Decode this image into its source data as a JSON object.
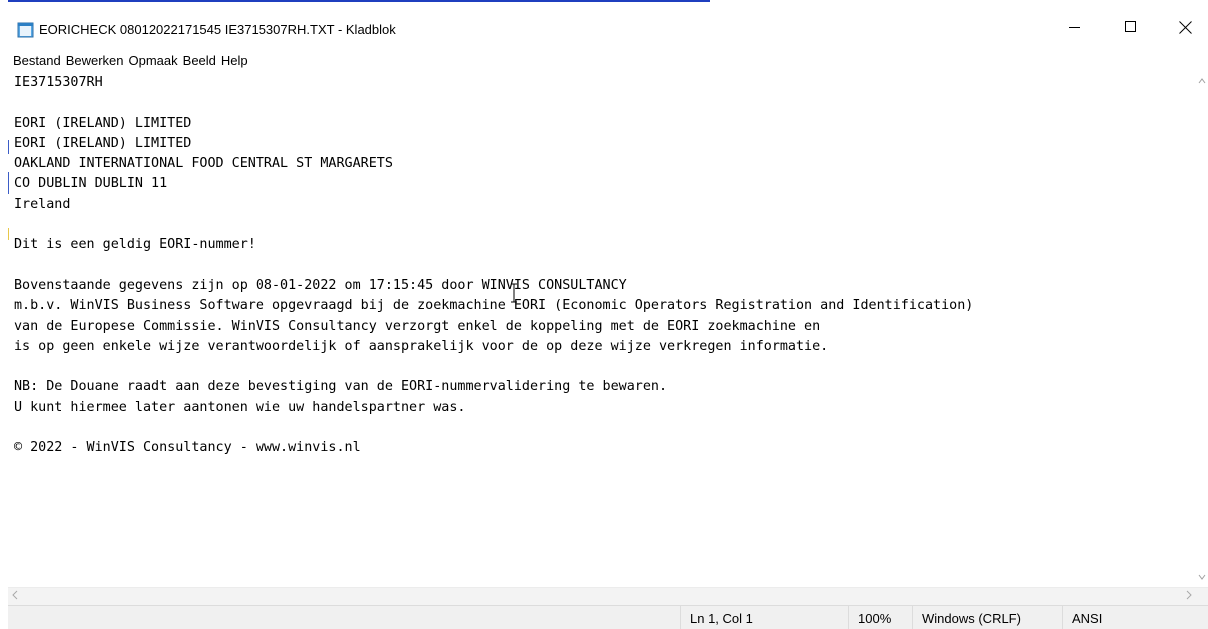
{
  "window": {
    "title": "EORICHECK 08012022171545 IE3715307RH.TXT - Kladblok",
    "app_icon": "notepad-icon",
    "controls": {
      "minimize_icon": "minimize-icon",
      "maximize_icon": "maximize-icon",
      "close_icon": "close-icon"
    }
  },
  "menu": {
    "items": [
      "Bestand",
      "Bewerken",
      "Opmaak",
      "Beeld",
      "Help"
    ]
  },
  "document": {
    "lines": [
      "IE3715307RH",
      "",
      "EORI (IRELAND) LIMITED",
      "EORI (IRELAND) LIMITED",
      "OAKLAND INTERNATIONAL FOOD CENTRAL ST MARGARETS",
      "CO DUBLIN DUBLIN 11",
      "Ireland",
      "",
      "Dit is een geldig EORI-nummer!",
      "",
      "Bovenstaande gegevens zijn op 08-01-2022 om 17:15:45 door WINVIS CONSULTANCY",
      "m.b.v. WinVIS Business Software opgevraagd bij de zoekmachine EORI (Economic Operators Registration and Identification)",
      "van de Europese Commissie. WinVIS Consultancy verzorgt enkel de koppeling met de EORI zoekmachine en",
      "is op geen enkele wijze verantwoordelijk of aansprakelijk voor de op deze wijze verkregen informatie.",
      "",
      "NB: De Douane raadt aan deze bevestiging van de EORI-nummervalidering te bewaren.",
      "U kunt hiermee later aantonen wie uw handelspartner was.",
      "",
      "© 2022 - WinVIS Consultancy - www.winvis.nl"
    ]
  },
  "statusbar": {
    "position": "Ln 1, Col 1",
    "zoom": "100%",
    "line_ending": "Windows (CRLF)",
    "encoding": "ANSI"
  },
  "colors": {
    "accent": "#1f3fbf",
    "statusbar_bg": "#f0f0f0"
  }
}
